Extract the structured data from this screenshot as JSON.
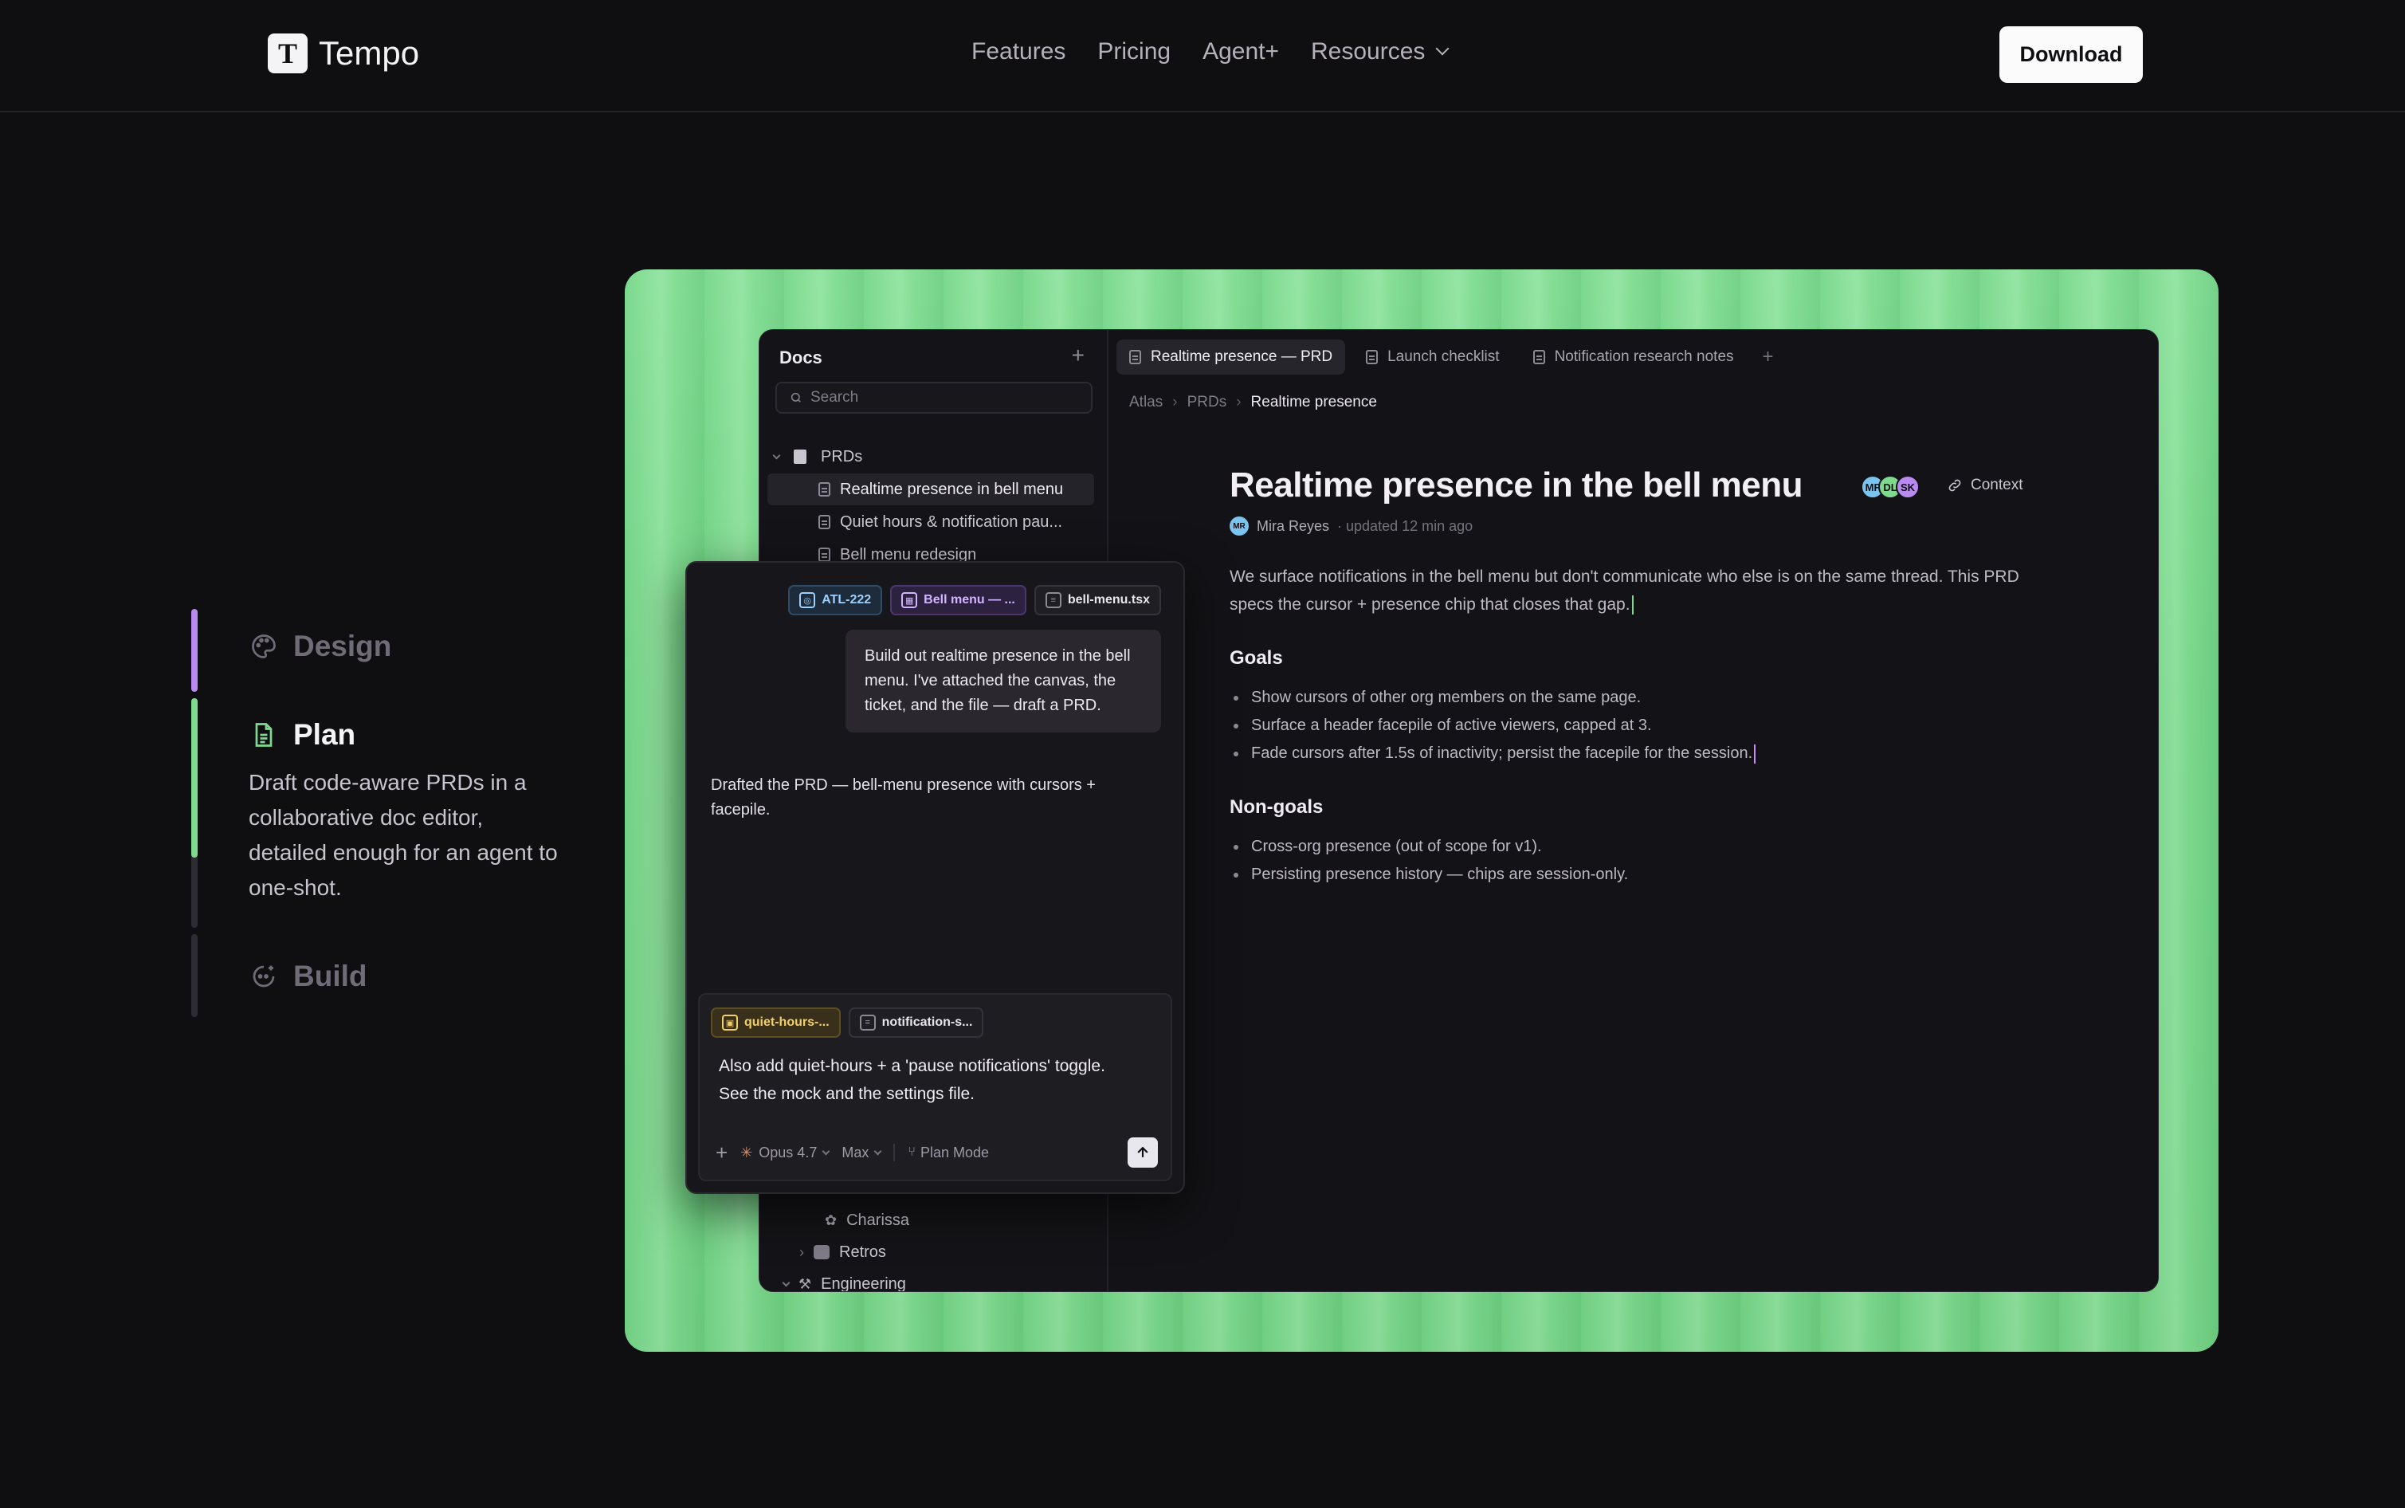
{
  "nav": {
    "brand": "Tempo",
    "brand_logo_letter": "T",
    "links": [
      "Features",
      "Pricing",
      "Agent+",
      "Resources"
    ],
    "download_label": "Download"
  },
  "steps": [
    {
      "title": "Design",
      "active": false,
      "bar_color": "#b98bf0"
    },
    {
      "title": "Plan",
      "active": true,
      "bar_color": "#7fd98f",
      "description": "Draft code-aware PRDs in a collaborative doc editor, detailed enough for an agent to one-shot.",
      "progress": 0.6
    },
    {
      "title": "Build",
      "active": false,
      "bar_color": "#2e2c33"
    }
  ],
  "app": {
    "sidebar": {
      "title": "Docs",
      "search_placeholder": "Search",
      "folder": "PRDs",
      "items": [
        "Realtime presence in bell menu",
        "Quiet hours & notification pau...",
        "Bell menu redesign"
      ],
      "lower_items": [
        "Charissa",
        "Retros",
        "Engineering"
      ]
    },
    "tabs": [
      "Realtime presence — PRD",
      "Launch checklist",
      "Notification research notes"
    ],
    "breadcrumb": [
      "Atlas",
      "PRDs",
      "Realtime presence"
    ],
    "doc": {
      "title": "Realtime presence in the bell menu",
      "facepile": [
        "MF",
        "DL",
        "SK"
      ],
      "context_label": "Context",
      "author_initials": "MR",
      "author": "Mira Reyes",
      "updated": "· updated 12 min ago",
      "intro": "We surface notifications in the bell menu but don't communicate who else is on the same thread. This PRD specs the cursor + presence chip that closes that gap.",
      "goals_heading": "Goals",
      "goals": [
        "Show cursors of other org members on the same page.",
        "Surface a header facepile of active viewers, capped at 3.",
        "Fade cursors after 1.5s of inactivity; persist the facepile for the session."
      ],
      "nongoals_heading": "Non-goals",
      "nongoals": [
        "Cross-org presence (out of scope for v1).",
        "Persisting presence history — chips are session-only."
      ]
    }
  },
  "chat": {
    "context_chips": [
      "ATL-222",
      "Bell menu — ...",
      "bell-menu.tsx"
    ],
    "user_message": "Build out realtime presence in the bell menu. I've attached the canvas, the ticket, and the file — draft a PRD.",
    "assistant_message": "Drafted the PRD — bell-menu presence with cursors + facepile.",
    "composer": {
      "chips": [
        "quiet-hours-...",
        "notification-s..."
      ],
      "text": "Also add quiet-hours + a 'pause notifications' toggle. See the mock and the settings file.",
      "model": "Opus 4.7",
      "effort": "Max",
      "mode": "Plan Mode"
    }
  },
  "colors": {
    "stage_green": "#7fdc90",
    "accent_purple": "#b98bf0",
    "accent_green": "#7fd98f"
  }
}
